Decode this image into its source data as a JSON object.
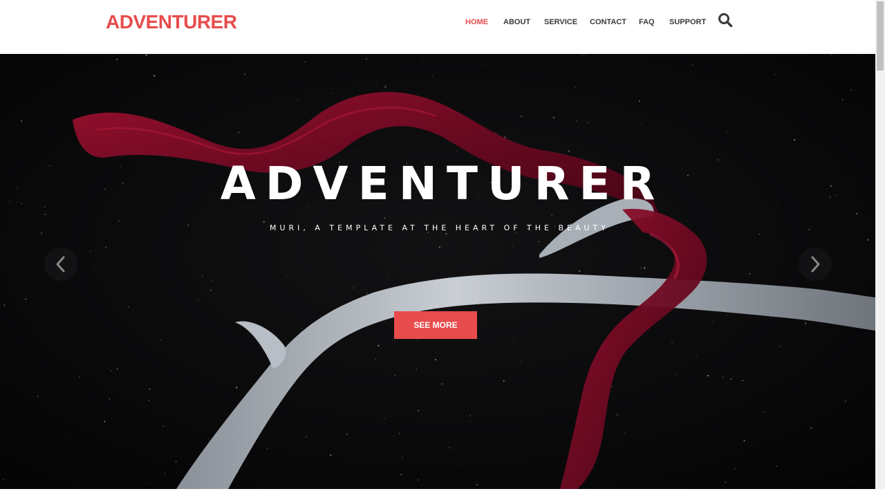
{
  "brand": {
    "logo_text": "ADVENTURER",
    "accent_color": "#e84c4c"
  },
  "nav": {
    "items": [
      {
        "label": "HOME",
        "active": true
      },
      {
        "label": "ABOUT",
        "active": false
      },
      {
        "label": "SERVICE",
        "active": false
      },
      {
        "label": "CONTACT",
        "active": false
      },
      {
        "label": "FAQ",
        "active": false
      },
      {
        "label": "SUPPORT",
        "active": false
      }
    ],
    "search_icon": "search-icon"
  },
  "hero": {
    "title": "ADVENTURER",
    "subtitle": "MURI, A TEMPLATE AT THE HEART OF THE BEAUTY",
    "cta_label": "SEE MORE",
    "prev_icon": "chevron-left-icon",
    "next_icon": "chevron-right-icon",
    "background_color": "#08080a"
  }
}
